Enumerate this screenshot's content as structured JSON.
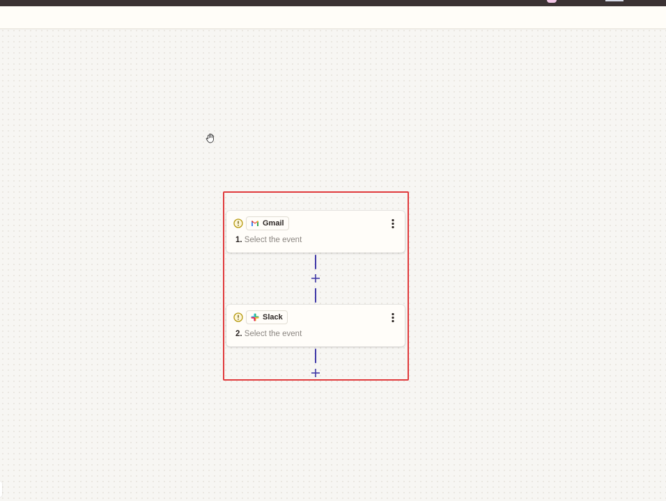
{
  "colors": {
    "top_bar": "#3b3233",
    "canvas": "#f7f6f3",
    "selection_border": "#e0393b",
    "connector": "#3f38a8",
    "warning": "#b5980c"
  },
  "canvas": {
    "cursor_icon": "hand-grab-icon"
  },
  "steps": [
    {
      "number": "1.",
      "app": "Gmail",
      "app_icon": "gmail-icon",
      "status_icon": "warning-icon",
      "placeholder": "Select the event"
    },
    {
      "number": "2.",
      "app": "Slack",
      "app_icon": "slack-icon",
      "status_icon": "warning-icon",
      "placeholder": "Select the event"
    }
  ]
}
